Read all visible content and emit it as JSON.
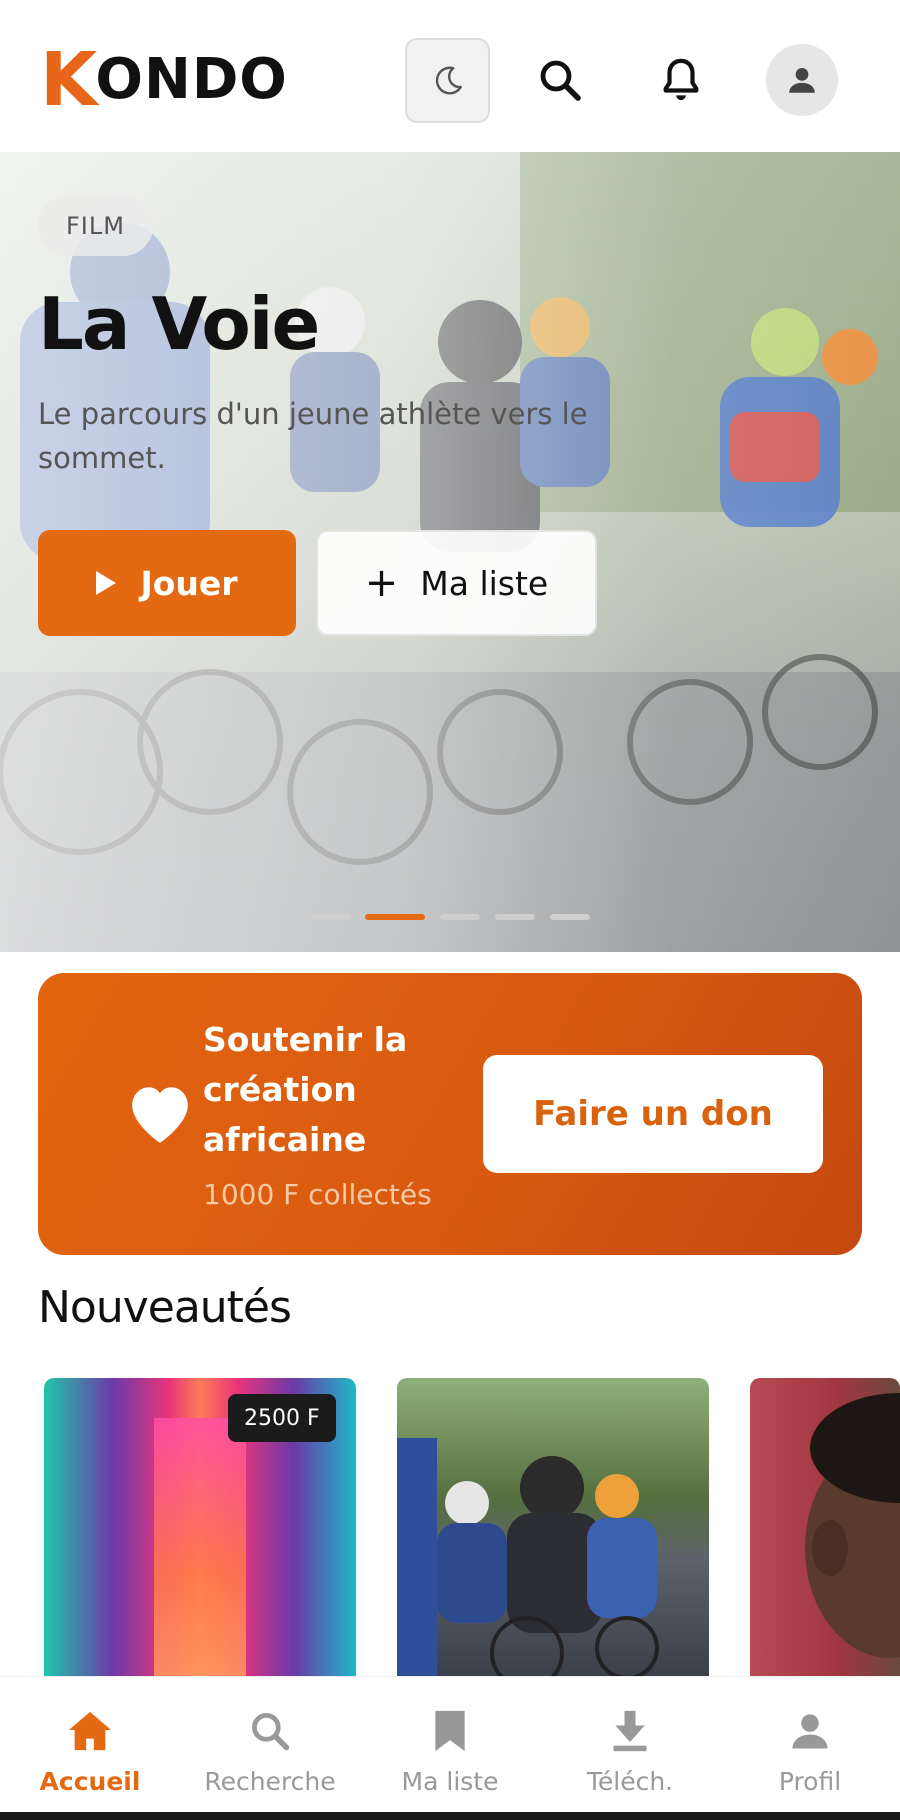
{
  "app": {
    "logo_text": "KONDO",
    "accent_color": "#e36a12"
  },
  "header": {
    "icons": [
      "moon-icon",
      "search-icon",
      "bell-icon",
      "user-icon"
    ]
  },
  "hero": {
    "tag": "FILM",
    "title": "La Voie",
    "description": "Le parcours d'un jeune athlète vers le sommet.",
    "play_label": "Jouer",
    "my_list_label": "Ma liste",
    "carousel_total": 5,
    "carousel_active": 2
  },
  "donation": {
    "title": "Soutenir la création africaine",
    "collected": "1000 F collectés",
    "button_label": "Faire un don",
    "icon": "heart-icon"
  },
  "new_releases": {
    "title": "Nouveautés",
    "items": [
      {
        "price": "2500 F"
      },
      {
        "price": ""
      },
      {
        "price": ""
      }
    ]
  },
  "bottom_nav": {
    "items": [
      {
        "label": "Accueil",
        "icon": "home-icon",
        "active": true
      },
      {
        "label": "Recherche",
        "icon": "search-icon",
        "active": false
      },
      {
        "label": "Ma liste",
        "icon": "bookmark-icon",
        "active": false
      },
      {
        "label": "Téléch.",
        "icon": "download-icon",
        "active": false
      },
      {
        "label": "Profil",
        "icon": "user-icon",
        "active": false
      }
    ]
  }
}
